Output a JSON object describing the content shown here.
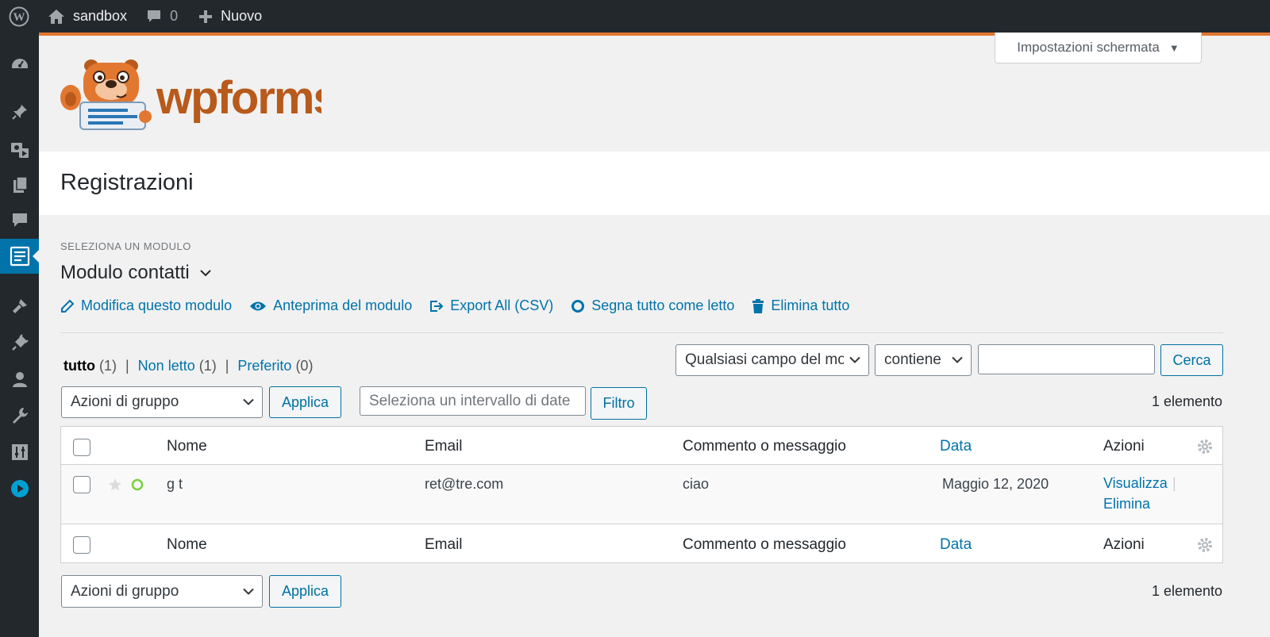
{
  "admin_bar": {
    "site_name": "sandbox",
    "comments_count": "0",
    "new_label": "Nuovo"
  },
  "sidebar": {
    "icons": [
      "dashboard-icon",
      "pin-icon",
      "media-icon",
      "pages-icon",
      "comments-icon",
      "wpforms-icon",
      "appearance-icon",
      "plugins-icon",
      "users-icon",
      "tools-icon",
      "settings-icon",
      "play-icon"
    ],
    "active": "wpforms-icon"
  },
  "header": {
    "logo_text": "wpforms",
    "screen_options": "Impostazioni schermata"
  },
  "page": {
    "title": "Registrazioni",
    "select_label": "SELEZIONA UN MODULO",
    "form_name": "Modulo contatti"
  },
  "actions": {
    "edit": "Modifica questo modulo",
    "preview": "Anteprima del modulo",
    "export": "Export All (CSV)",
    "mark_read": "Segna tutto come letto",
    "delete_all": "Elimina tutto"
  },
  "views": {
    "all": {
      "label": "tutto",
      "count": "(1)"
    },
    "unread": {
      "label": "Non letto",
      "count": "(1)"
    },
    "starred": {
      "label": "Preferito",
      "count": "(0)"
    },
    "separator": "|"
  },
  "filters": {
    "field_select": "Qualsiasi campo del modulo",
    "operator_select": "contiene",
    "search_value": "",
    "search_button": "Cerca",
    "date_placeholder": "Seleziona un intervallo di date",
    "filter_button": "Filtro"
  },
  "bulk": {
    "select": "Azioni di gruppo",
    "apply": "Applica",
    "count": "1 elemento"
  },
  "table": {
    "columns": {
      "name": "Nome",
      "email": "Email",
      "comment": "Commento o messaggio",
      "date": "Data",
      "actions": "Azioni"
    },
    "rows": [
      {
        "name": "g t",
        "email": "ret@tre.com",
        "comment": "ciao",
        "date": "Maggio 12, 2020",
        "view": "Visualizza",
        "delete": "Elimina",
        "sep": "|"
      }
    ]
  },
  "colors": {
    "admin_dark": "#23282d",
    "link_blue": "#0073aa",
    "accent_orange": "#e27730",
    "unread_green": "#7ad03a"
  }
}
